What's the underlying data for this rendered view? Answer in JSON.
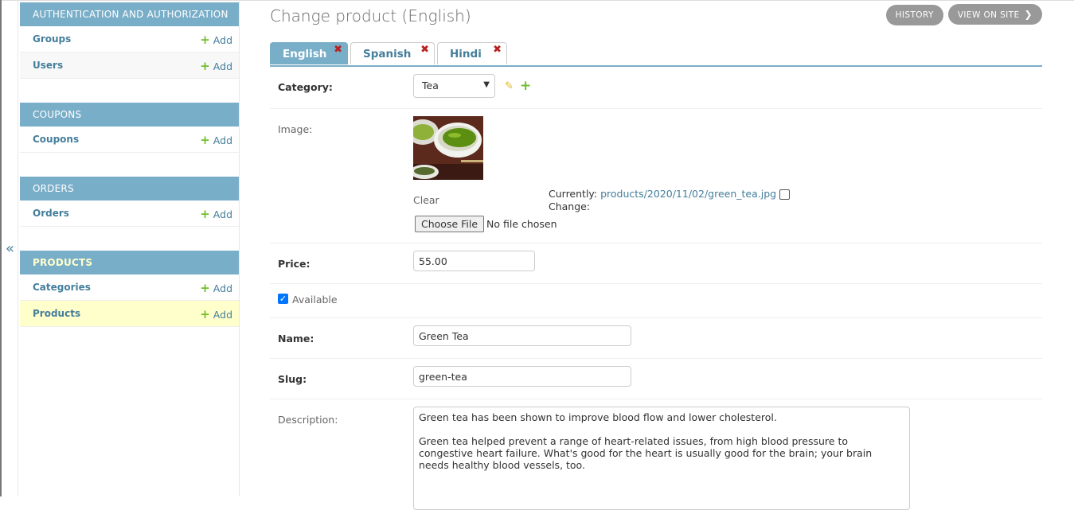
{
  "sidebar": {
    "collapse_glyph": "«",
    "modules": [
      {
        "title": "AUTHENTICATION AND AUTHORIZATION",
        "items": [
          {
            "label": "Groups",
            "add": "Add"
          },
          {
            "label": "Users",
            "add": "Add"
          }
        ]
      },
      {
        "title": "COUPONS",
        "items": [
          {
            "label": "Coupons",
            "add": "Add"
          }
        ]
      },
      {
        "title": "ORDERS",
        "items": [
          {
            "label": "Orders",
            "add": "Add"
          }
        ]
      },
      {
        "title": "PRODUCTS",
        "items": [
          {
            "label": "Categories",
            "add": "Add"
          },
          {
            "label": "Products",
            "add": "Add"
          }
        ]
      }
    ],
    "active_module": "PRODUCTS",
    "active_item": "Products"
  },
  "header": {
    "title": "Change product (English)",
    "history_label": "HISTORY",
    "view_on_site_label": "VIEW ON SITE"
  },
  "tabs": [
    {
      "label": "English",
      "current": true
    },
    {
      "label": "Spanish",
      "current": false
    },
    {
      "label": "Hindi",
      "current": false
    }
  ],
  "form": {
    "category": {
      "label": "Category:",
      "value": "Tea"
    },
    "image": {
      "label": "Image:",
      "clear_label": "Clear",
      "currently_label": "Currently:",
      "current_path": "products/2020/11/02/green_tea.jpg",
      "change_label": "Change:",
      "choose_file_label": "Choose File",
      "file_status": "No file chosen"
    },
    "price": {
      "label": "Price:",
      "value": "55.00"
    },
    "available": {
      "label": "Available",
      "checked": true
    },
    "name": {
      "label": "Name:",
      "value": "Green Tea"
    },
    "slug": {
      "label": "Slug:",
      "value": "green-tea"
    },
    "description": {
      "label": "Description:",
      "value": "Green tea has been shown to improve blood flow and lower cholesterol.\n\nGreen tea helped prevent a range of heart-related issues, from high blood pressure to congestive heart failure. What's good for the heart is usually good for the brain; your brain needs healthy blood vessels, too."
    }
  },
  "colors": {
    "module_header": "#79aec8",
    "link": "#447e9b",
    "add_plus": "#70bf2b",
    "selected_row": "#ffffcc",
    "delete_x": "#ba2121"
  }
}
